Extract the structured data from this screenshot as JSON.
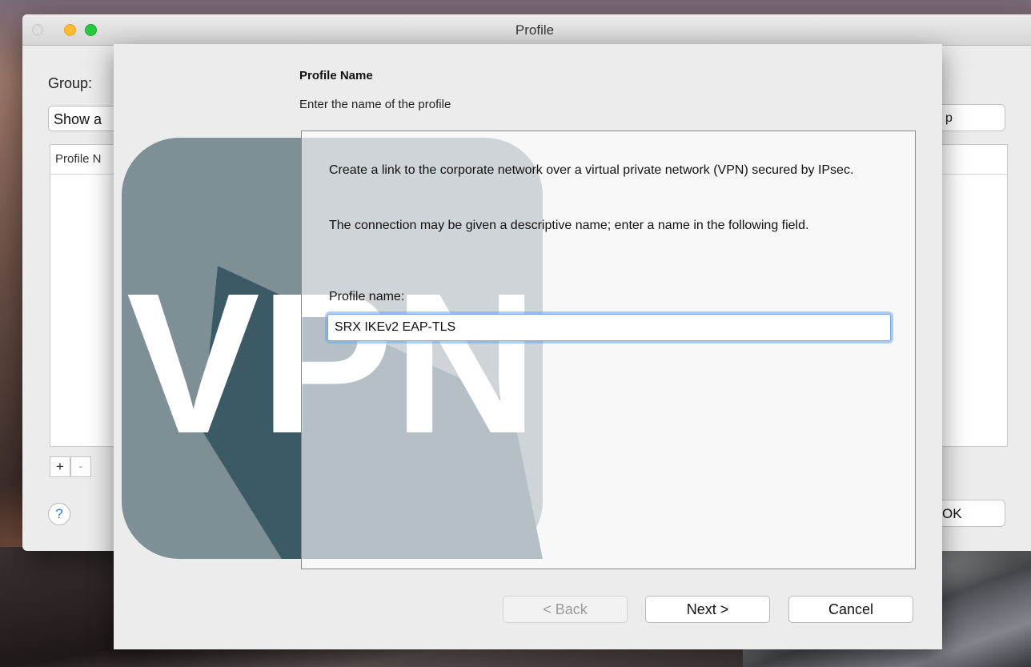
{
  "window": {
    "title": "Profile"
  },
  "main": {
    "group_label": "Group:",
    "group_value": "Show a",
    "right_button_label": "p",
    "table_header": "Profile N",
    "add_label": "+",
    "remove_label": "-",
    "help_label": "?",
    "ok_label": "OK"
  },
  "wizard": {
    "heading": "Profile Name",
    "subheading": "Enter the name of the profile",
    "logo_text": "VPN",
    "description_1": "Create a link to the corporate network over a virtual private network (VPN) secured by IPsec.",
    "description_2": "The connection may be given a descriptive name; enter a name in the following field.",
    "field_label": "Profile name:",
    "profile_name_value": "SRX IKEv2 EAP-TLS",
    "buttons": {
      "back": "< Back",
      "next": "Next >",
      "cancel": "Cancel"
    }
  },
  "colors": {
    "logo_tile": "#7e8f96",
    "logo_shadow": "#3c5a66",
    "focus_ring": "#6ea5e6",
    "traffic_min": "#febc2e",
    "traffic_max": "#28c840"
  }
}
